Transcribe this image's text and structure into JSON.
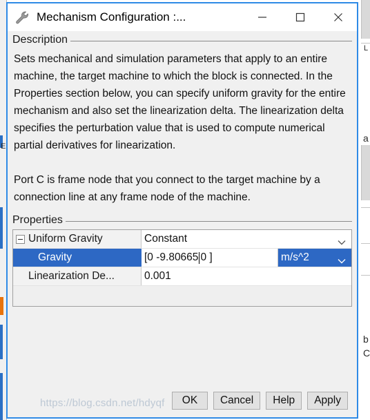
{
  "window": {
    "title": "Mechanism Configuration :...",
    "icon": "wrench-icon",
    "accent_border_color": "#2e8ae6",
    "controls": {
      "minimize": "minimize-icon",
      "maximize": "maximize-icon",
      "close": "close-icon"
    }
  },
  "description_group": {
    "label": "Description",
    "paragraphs": [
      "Sets mechanical and simulation parameters that apply to an entire machine, the target machine to which the block is connected. In the Properties section below, you can specify uniform gravity for the entire mechanism and also set the linearization delta. The linearization delta specifies the perturbation value that is used to compute numerical partial derivatives for linearization.",
      "Port C is frame node that you connect to the target machine by a connection line at any frame node of the machine."
    ]
  },
  "properties_group": {
    "label": "Properties",
    "rows": [
      {
        "name": "Uniform Gravity",
        "expander": "collapse-minus-box",
        "value": "Constant",
        "control": "dropdown",
        "selected": false
      },
      {
        "name": "Gravity",
        "value": "[0 -9.80665 0 ]",
        "value_before_caret": "[0 -9.80665 ",
        "value_after_caret": "0 ]",
        "unit": "m/s^2",
        "control": "editable-combo-with-unit",
        "selected": true
      },
      {
        "name": "Linearization De...",
        "value": "0.001",
        "control": "textbox",
        "selected": false
      }
    ],
    "selection_color": "#2d68c4"
  },
  "buttons": [
    {
      "id": "ok",
      "label": "OK"
    },
    {
      "id": "cancel",
      "label": "Cancel"
    },
    {
      "id": "help",
      "label": "Help"
    },
    {
      "id": "apply",
      "label": "Apply"
    }
  ],
  "watermark": "https://blog.csdn.net/hdyqf",
  "background_fragments": {
    "right_a": "a",
    "right_b": "b",
    "right_c": "C",
    "right_l": "L",
    "left_e": "E"
  }
}
